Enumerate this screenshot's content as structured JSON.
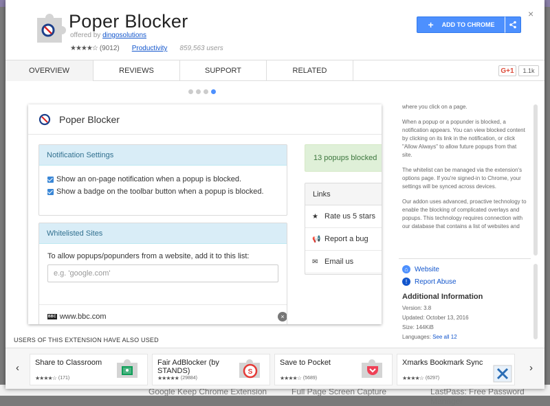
{
  "background": {
    "bottom_items": [
      "Google Keep Chrome Extension",
      "Full Page Screen Capture",
      "LastPass: Free Password Manager"
    ]
  },
  "header": {
    "title": "Poper Blocker",
    "offered_prefix": "offered by",
    "developer": "dingosolutions",
    "stars": "★★★★☆",
    "rating_count": "(9012)",
    "category": "Productivity",
    "users": "859,563 users",
    "add_button": "ADD TO CHROME",
    "close": "×"
  },
  "tabs": [
    "OVERVIEW",
    "REVIEWS",
    "SUPPORT",
    "RELATED"
  ],
  "social": {
    "gplus_label": "G+1",
    "gplus_count": "1.1k"
  },
  "screenshot": {
    "app_title": "Poper Blocker",
    "notification": {
      "heading": "Notification Settings",
      "options": [
        "Show an on-page notification when a popup is blocked.",
        "Show a badge on the toolbar button when a popup is blocked."
      ]
    },
    "whitelist": {
      "heading": "Whitelisted Sites",
      "instruction": "To allow popups/popunders from a website, add it to this list:",
      "placeholder": "e.g. 'google.com'",
      "bbc_logo": "BBC",
      "site": "www.bbc.com",
      "remove": "×"
    },
    "blocked_count": "13 popups blocked",
    "links": {
      "heading": "Links",
      "items": [
        "Rate us 5 stars",
        "Report a bug",
        "Email us"
      ]
    }
  },
  "description": {
    "paragraphs": [
      "where you click on a page.",
      "When a popup or a popunder is blocked, a notification appears. You can view blocked content by clicking on its link in the notification, or click \"Allow Always\" to allow future popups from that site.",
      "The whitelist can be managed via the extension's options page. If you're signed-in to Chrome, your settings will be synced across devices.",
      "Our addon uses advanced, proactive technology to enable the blocking of complicated overlays and popups. This technology requires connection with our database that contains a list of websites and"
    ]
  },
  "meta": {
    "website": "Website",
    "report": "Report Abuse",
    "heading": "Additional Information",
    "version": "Version: 3.8",
    "updated": "Updated: October 13, 2016",
    "size": "Size: 144KiB",
    "languages_label": "Languages:",
    "languages_link": "See all 12"
  },
  "related": {
    "heading": "USERS OF THIS EXTENSION HAVE ALSO USED",
    "prev": "‹",
    "next": "›",
    "items": [
      {
        "name": "Share to Classroom",
        "stars": "★★★★☆",
        "count": "(171)"
      },
      {
        "name": "Fair AdBlocker (by STANDS)",
        "stars": "★★★★★",
        "count": "(29884)"
      },
      {
        "name": "Save to Pocket",
        "stars": "★★★★☆",
        "count": "(5689)"
      },
      {
        "name": "Xmarks Bookmark Sync",
        "stars": "★★★★☆",
        "count": "(6297)"
      }
    ]
  },
  "colors": {
    "accent": "#4d90fe",
    "link": "#1155cc",
    "panel_head": "#d9edf7",
    "success": "#dff0d8"
  }
}
